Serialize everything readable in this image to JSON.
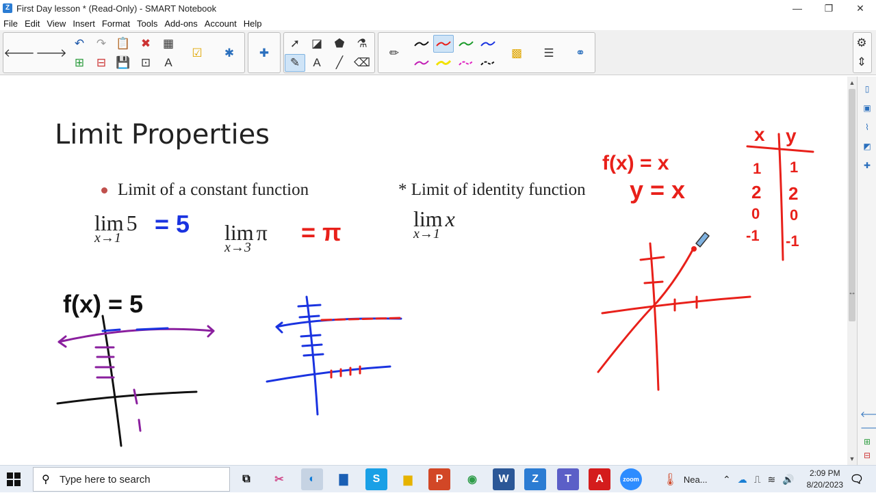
{
  "window": {
    "title": "First Day lesson * (Read-Only) - SMART Notebook",
    "minimize": "—",
    "maximize": "❐",
    "close": "✕"
  },
  "menu": [
    "File",
    "Edit",
    "View",
    "Insert",
    "Format",
    "Tools",
    "Add-ons",
    "Account",
    "Help"
  ],
  "slide": {
    "title": "Limit Properties",
    "bullet1": "Limit of a constant function",
    "bullet2": "* Limit of identity function",
    "math1": {
      "lim": "lim",
      "sub": "x→1",
      "arg": "5"
    },
    "math2": {
      "lim": "lim",
      "sub": "x→3",
      "arg": "π"
    },
    "math3": {
      "lim": "lim",
      "sub": "x→1",
      "arg": "x"
    }
  },
  "ink_text": {
    "ans1": "= 5",
    "ans2": "= π",
    "fx_const": "f(x) = 5",
    "fx_id": "f(x) = x",
    "y_id": "y = x",
    "table_head_x": "x",
    "table_head_y": "y",
    "table_x": [
      "1",
      "2",
      "0",
      "-1"
    ],
    "table_y": [
      "1",
      "2",
      "0",
      "-1"
    ]
  },
  "colors": {
    "ink_red": "#e8201a",
    "ink_blue": "#1a33e0",
    "ink_purple": "#8a1f9e",
    "ink_black": "#111111",
    "bullet": "#c0504d"
  },
  "taskbar": {
    "search_placeholder": "Type here to search",
    "weather": "Nea...",
    "time": "2:09 PM",
    "date": "8/20/2023"
  }
}
